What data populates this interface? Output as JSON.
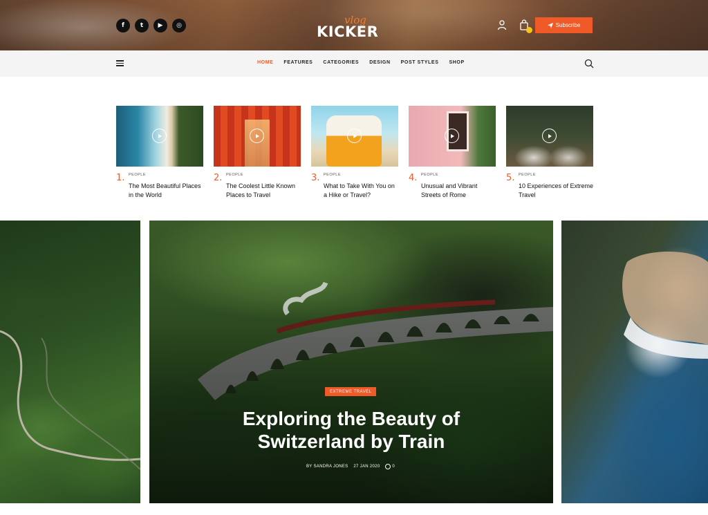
{
  "header": {
    "socials": [
      {
        "icon": "facebook-icon",
        "glyph": "f"
      },
      {
        "icon": "twitter-icon",
        "glyph": "t"
      },
      {
        "icon": "youtube-icon",
        "glyph": "▶"
      },
      {
        "icon": "instagram-icon",
        "glyph": "◎"
      }
    ],
    "logo_script": "vlog",
    "logo_main": "KICKER",
    "subscribe_label": "Subscribe"
  },
  "nav": {
    "items": [
      {
        "label": "HOME",
        "active": true
      },
      {
        "label": "FEATURES",
        "active": false
      },
      {
        "label": "CATEGORIES",
        "active": false
      },
      {
        "label": "DESIGN",
        "active": false
      },
      {
        "label": "POST STYLES",
        "active": false
      },
      {
        "label": "SHOP",
        "active": false
      }
    ]
  },
  "cards": [
    {
      "num": "1.",
      "category": "PEOPLE",
      "title": "The Most Beautiful Places in the World"
    },
    {
      "num": "2.",
      "category": "PEOPLE",
      "title": "The Coolest Little Known Places to Travel"
    },
    {
      "num": "3.",
      "category": "PEOPLE",
      "title": "What to Take With You on a Hike or Travel?"
    },
    {
      "num": "4.",
      "category": "PEOPLE",
      "title": "Unusual and Vibrant Streets of Rome"
    },
    {
      "num": "5.",
      "category": "PEOPLE",
      "title": "10 Experiences of Extreme Travel"
    }
  ],
  "hero": {
    "tag": "EXTREME TRAVEL",
    "title": "Exploring the Beauty of Switzerland by Train",
    "author": "BY SANDRA JONES",
    "date": "27 JAN 2020",
    "comments": "0"
  },
  "colors": {
    "accent": "#f05a28"
  }
}
